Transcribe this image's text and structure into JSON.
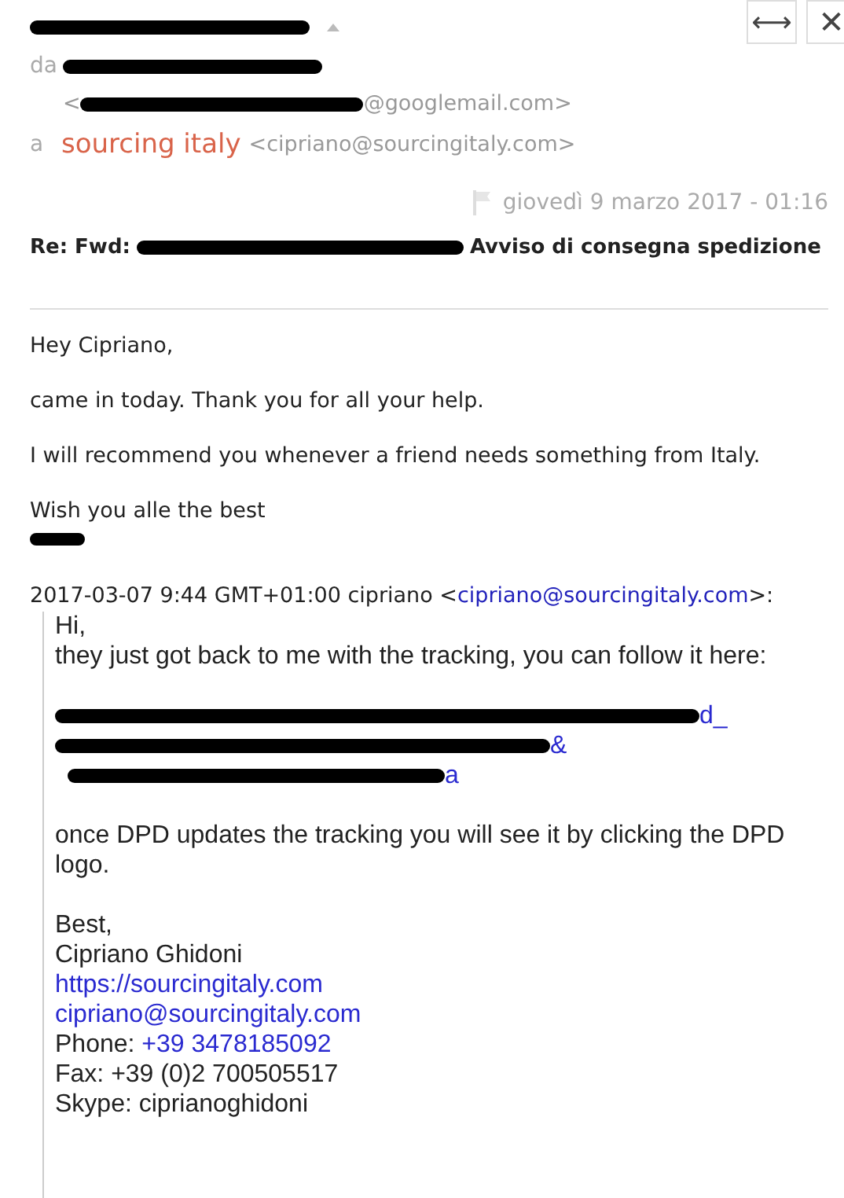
{
  "header": {
    "sender_redacted": true,
    "expanded": true,
    "from": {
      "label": "da",
      "name_redacted": true,
      "email_start": "<",
      "email_redacted": true,
      "email_end": "@googlemail.com>"
    },
    "to": {
      "label": "a",
      "name": "sourcing italy",
      "email": "<cipriano@sourcingitaly.com>"
    },
    "flagged": false,
    "date": "giovedì 9 marzo 2017 - 01:16",
    "subject": {
      "start": "Re: Fwd:",
      "redacted": true,
      "end": "Avviso di consegna spedizione"
    },
    "buttons": [
      {
        "kind": "expand",
        "label": "⟷"
      },
      {
        "kind": "close",
        "label": "✕"
      }
    ]
  },
  "body": {
    "paragraphs": [
      "Hey Cipriano,",
      "came in today. Thank you for all your help.",
      "I will recommend you whenever a friend needs something from Italy.",
      "Wish you alle the best"
    ],
    "signature_redacted": true
  },
  "quote": {
    "intro": "2017-03-07 9:44 GMT+01:00 cipriano <",
    "intro_link": "cipriano@sourcingitaly.com",
    "intro_end": ">:",
    "lines": [
      "Hi,",
      "they just got back to me with the tracking, you can follow it here:"
    ],
    "tracking_link": {
      "redacted": true,
      "lines": [
        "d_",
        "&",
        "a"
      ]
    },
    "after": "once DPD updates the tracking you will see it by clicking the DPD logo.",
    "signature": [
      {
        "kind": "text",
        "text": "Best,"
      },
      {
        "kind": "text",
        "text": "Cipriano Ghidoni"
      },
      {
        "kind": "link",
        "text": "https://sourcingitaly.com"
      },
      {
        "kind": "link",
        "text": "cipriano@sourcingitaly.com"
      },
      {
        "kind": "labeled_link",
        "label": "Phone:",
        "text": "+39 3478185092"
      },
      {
        "kind": "text",
        "text": "Fax: +39 (0)2 700505517"
      },
      {
        "kind": "text",
        "text": "Skype: ciprianoghidoni"
      }
    ]
  }
}
